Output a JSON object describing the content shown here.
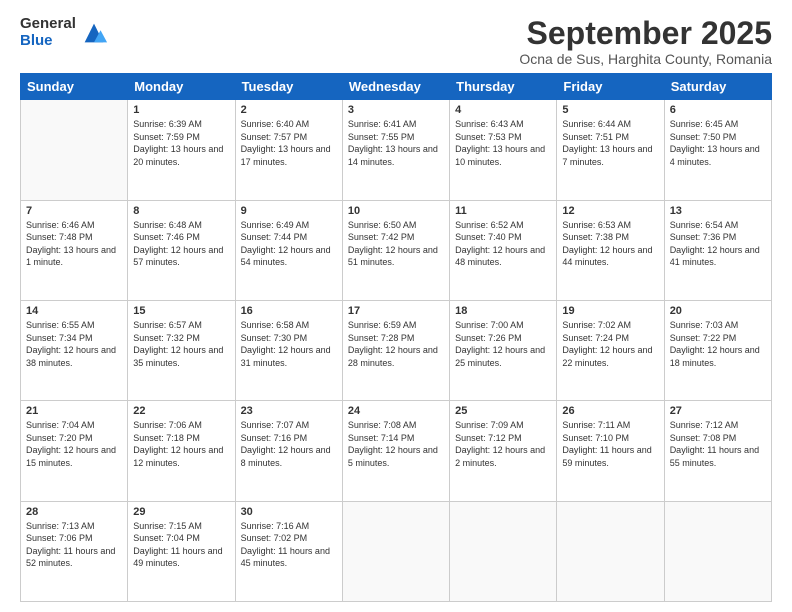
{
  "logo": {
    "general": "General",
    "blue": "Blue"
  },
  "header": {
    "month_title": "September 2025",
    "subtitle": "Ocna de Sus, Harghita County, Romania"
  },
  "weekdays": [
    "Sunday",
    "Monday",
    "Tuesday",
    "Wednesday",
    "Thursday",
    "Friday",
    "Saturday"
  ],
  "weeks": [
    [
      {
        "day": "",
        "sunrise": "",
        "sunset": "",
        "daylight": ""
      },
      {
        "day": "1",
        "sunrise": "Sunrise: 6:39 AM",
        "sunset": "Sunset: 7:59 PM",
        "daylight": "Daylight: 13 hours and 20 minutes."
      },
      {
        "day": "2",
        "sunrise": "Sunrise: 6:40 AM",
        "sunset": "Sunset: 7:57 PM",
        "daylight": "Daylight: 13 hours and 17 minutes."
      },
      {
        "day": "3",
        "sunrise": "Sunrise: 6:41 AM",
        "sunset": "Sunset: 7:55 PM",
        "daylight": "Daylight: 13 hours and 14 minutes."
      },
      {
        "day": "4",
        "sunrise": "Sunrise: 6:43 AM",
        "sunset": "Sunset: 7:53 PM",
        "daylight": "Daylight: 13 hours and 10 minutes."
      },
      {
        "day": "5",
        "sunrise": "Sunrise: 6:44 AM",
        "sunset": "Sunset: 7:51 PM",
        "daylight": "Daylight: 13 hours and 7 minutes."
      },
      {
        "day": "6",
        "sunrise": "Sunrise: 6:45 AM",
        "sunset": "Sunset: 7:50 PM",
        "daylight": "Daylight: 13 hours and 4 minutes."
      }
    ],
    [
      {
        "day": "7",
        "sunrise": "Sunrise: 6:46 AM",
        "sunset": "Sunset: 7:48 PM",
        "daylight": "Daylight: 13 hours and 1 minute."
      },
      {
        "day": "8",
        "sunrise": "Sunrise: 6:48 AM",
        "sunset": "Sunset: 7:46 PM",
        "daylight": "Daylight: 12 hours and 57 minutes."
      },
      {
        "day": "9",
        "sunrise": "Sunrise: 6:49 AM",
        "sunset": "Sunset: 7:44 PM",
        "daylight": "Daylight: 12 hours and 54 minutes."
      },
      {
        "day": "10",
        "sunrise": "Sunrise: 6:50 AM",
        "sunset": "Sunset: 7:42 PM",
        "daylight": "Daylight: 12 hours and 51 minutes."
      },
      {
        "day": "11",
        "sunrise": "Sunrise: 6:52 AM",
        "sunset": "Sunset: 7:40 PM",
        "daylight": "Daylight: 12 hours and 48 minutes."
      },
      {
        "day": "12",
        "sunrise": "Sunrise: 6:53 AM",
        "sunset": "Sunset: 7:38 PM",
        "daylight": "Daylight: 12 hours and 44 minutes."
      },
      {
        "day": "13",
        "sunrise": "Sunrise: 6:54 AM",
        "sunset": "Sunset: 7:36 PM",
        "daylight": "Daylight: 12 hours and 41 minutes."
      }
    ],
    [
      {
        "day": "14",
        "sunrise": "Sunrise: 6:55 AM",
        "sunset": "Sunset: 7:34 PM",
        "daylight": "Daylight: 12 hours and 38 minutes."
      },
      {
        "day": "15",
        "sunrise": "Sunrise: 6:57 AM",
        "sunset": "Sunset: 7:32 PM",
        "daylight": "Daylight: 12 hours and 35 minutes."
      },
      {
        "day": "16",
        "sunrise": "Sunrise: 6:58 AM",
        "sunset": "Sunset: 7:30 PM",
        "daylight": "Daylight: 12 hours and 31 minutes."
      },
      {
        "day": "17",
        "sunrise": "Sunrise: 6:59 AM",
        "sunset": "Sunset: 7:28 PM",
        "daylight": "Daylight: 12 hours and 28 minutes."
      },
      {
        "day": "18",
        "sunrise": "Sunrise: 7:00 AM",
        "sunset": "Sunset: 7:26 PM",
        "daylight": "Daylight: 12 hours and 25 minutes."
      },
      {
        "day": "19",
        "sunrise": "Sunrise: 7:02 AM",
        "sunset": "Sunset: 7:24 PM",
        "daylight": "Daylight: 12 hours and 22 minutes."
      },
      {
        "day": "20",
        "sunrise": "Sunrise: 7:03 AM",
        "sunset": "Sunset: 7:22 PM",
        "daylight": "Daylight: 12 hours and 18 minutes."
      }
    ],
    [
      {
        "day": "21",
        "sunrise": "Sunrise: 7:04 AM",
        "sunset": "Sunset: 7:20 PM",
        "daylight": "Daylight: 12 hours and 15 minutes."
      },
      {
        "day": "22",
        "sunrise": "Sunrise: 7:06 AM",
        "sunset": "Sunset: 7:18 PM",
        "daylight": "Daylight: 12 hours and 12 minutes."
      },
      {
        "day": "23",
        "sunrise": "Sunrise: 7:07 AM",
        "sunset": "Sunset: 7:16 PM",
        "daylight": "Daylight: 12 hours and 8 minutes."
      },
      {
        "day": "24",
        "sunrise": "Sunrise: 7:08 AM",
        "sunset": "Sunset: 7:14 PM",
        "daylight": "Daylight: 12 hours and 5 minutes."
      },
      {
        "day": "25",
        "sunrise": "Sunrise: 7:09 AM",
        "sunset": "Sunset: 7:12 PM",
        "daylight": "Daylight: 12 hours and 2 minutes."
      },
      {
        "day": "26",
        "sunrise": "Sunrise: 7:11 AM",
        "sunset": "Sunset: 7:10 PM",
        "daylight": "Daylight: 11 hours and 59 minutes."
      },
      {
        "day": "27",
        "sunrise": "Sunrise: 7:12 AM",
        "sunset": "Sunset: 7:08 PM",
        "daylight": "Daylight: 11 hours and 55 minutes."
      }
    ],
    [
      {
        "day": "28",
        "sunrise": "Sunrise: 7:13 AM",
        "sunset": "Sunset: 7:06 PM",
        "daylight": "Daylight: 11 hours and 52 minutes."
      },
      {
        "day": "29",
        "sunrise": "Sunrise: 7:15 AM",
        "sunset": "Sunset: 7:04 PM",
        "daylight": "Daylight: 11 hours and 49 minutes."
      },
      {
        "day": "30",
        "sunrise": "Sunrise: 7:16 AM",
        "sunset": "Sunset: 7:02 PM",
        "daylight": "Daylight: 11 hours and 45 minutes."
      },
      {
        "day": "",
        "sunrise": "",
        "sunset": "",
        "daylight": ""
      },
      {
        "day": "",
        "sunrise": "",
        "sunset": "",
        "daylight": ""
      },
      {
        "day": "",
        "sunrise": "",
        "sunset": "",
        "daylight": ""
      },
      {
        "day": "",
        "sunrise": "",
        "sunset": "",
        "daylight": ""
      }
    ]
  ]
}
